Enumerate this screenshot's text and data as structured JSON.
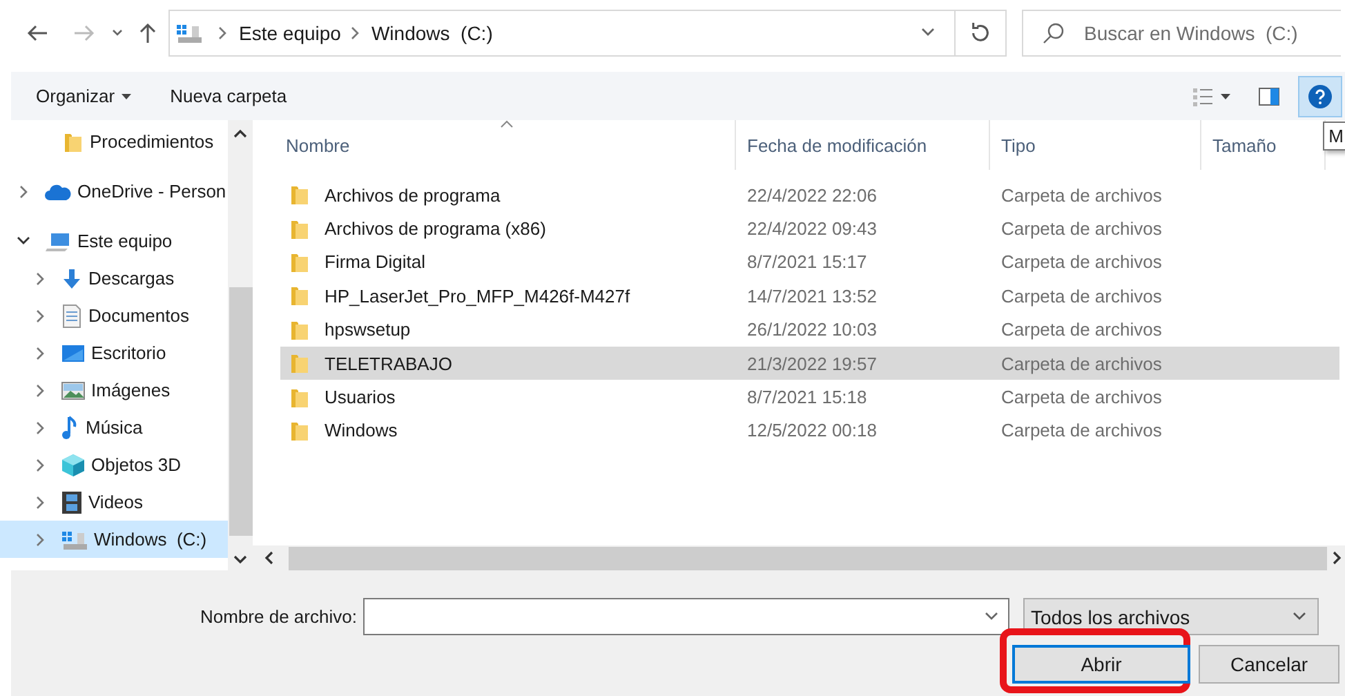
{
  "address": {
    "crumbs": [
      "Este equipo",
      "Windows  (C:)"
    ]
  },
  "search": {
    "placeholder": "Buscar en Windows  (C:)"
  },
  "toolbar": {
    "buttons": [
      {
        "label": "Organizar",
        "kind": "menu"
      },
      {
        "label": "Nueva carpeta",
        "kind": "plain"
      }
    ],
    "help": {
      "selected": true
    }
  },
  "tooltip": "M",
  "sidebar": {
    "items": [
      {
        "label": "Procedimientos",
        "kind": "folder",
        "selected": false
      },
      {
        "label": "OneDrive - Person",
        "kind": "cloud",
        "expanded": false,
        "selected": false
      },
      {
        "label": "Este equipo",
        "kind": "pc",
        "expanded": true,
        "selected": false,
        "children": [
          {
            "label": "Descargas",
            "kind": "download",
            "expanded": false,
            "selected": false
          },
          {
            "label": "Documentos",
            "kind": "document",
            "expanded": false,
            "selected": false
          },
          {
            "label": "Escritorio",
            "kind": "desktop",
            "expanded": false,
            "selected": false
          },
          {
            "label": "Imágenes",
            "kind": "pictures",
            "expanded": false,
            "selected": false
          },
          {
            "label": "Música",
            "kind": "music",
            "expanded": false,
            "selected": false
          },
          {
            "label": "Objetos 3D",
            "kind": "cube",
            "expanded": false,
            "selected": false
          },
          {
            "label": "Videos",
            "kind": "video",
            "expanded": false,
            "selected": false
          },
          {
            "label": "Windows  (C:)",
            "kind": "drive",
            "expanded": false,
            "selected": true
          }
        ]
      }
    ]
  },
  "table": {
    "columns": [
      {
        "label": "Nombre",
        "sorted": true
      },
      {
        "label": "Fecha de modificación",
        "sorted": false
      },
      {
        "label": "Tipo",
        "sorted": false
      },
      {
        "label": "Tamaño",
        "sorted": false
      }
    ],
    "rows": [
      {
        "name": "Archivos de programa",
        "date": "22/4/2022 22:06",
        "type": "Carpeta de archivos",
        "selected": false
      },
      {
        "name": "Archivos de programa (x86)",
        "date": "22/4/2022 09:43",
        "type": "Carpeta de archivos",
        "selected": false
      },
      {
        "name": "Firma Digital",
        "date": "8/7/2021 15:17",
        "type": "Carpeta de archivos",
        "selected": false
      },
      {
        "name": "HP_LaserJet_Pro_MFP_M426f-M427f",
        "date": "14/7/2021 13:52",
        "type": "Carpeta de archivos",
        "selected": false
      },
      {
        "name": "hpswsetup",
        "date": "26/1/2022 10:03",
        "type": "Carpeta de archivos",
        "selected": false
      },
      {
        "name": "TELETRABAJO",
        "date": "21/3/2022 19:57",
        "type": "Carpeta de archivos",
        "selected": true
      },
      {
        "name": "Usuarios",
        "date": "8/7/2021 15:18",
        "type": "Carpeta de archivos",
        "selected": false
      },
      {
        "name": "Windows",
        "date": "12/5/2022 00:18",
        "type": "Carpeta de archivos",
        "selected": false
      }
    ]
  },
  "footer": {
    "filename_label": "Nombre de archivo:",
    "filter": "Todos los archivos",
    "buttons": [
      {
        "label": "Abrir",
        "kind": "primary",
        "highlighted": true
      },
      {
        "label": "Cancelar",
        "kind": "secondary",
        "highlighted": false
      }
    ]
  }
}
